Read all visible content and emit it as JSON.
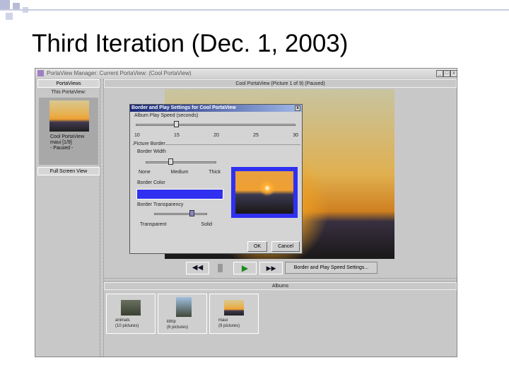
{
  "slide_title": "Third Iteration (Dec. 1, 2003)",
  "window": {
    "title": "PortaView Manager: Current PortaView: (Cool PortaView)",
    "min": "_",
    "max": "□",
    "close": "x"
  },
  "left": {
    "portaviews": "PortaViews",
    "this_portaview": "This PortaView:",
    "name": "Cool PortaView",
    "album": "maui [1/9]",
    "status": "- Paused -",
    "fullscreen": "Full Screen View"
  },
  "main": {
    "header": "Cool PortaView (Picture 1 of 9) (Paused)",
    "settings_button": "Border and Play Speed Settings...",
    "albums_header": "Albums"
  },
  "dialog": {
    "title": "Border and Play Settings for Cool PortaView",
    "close": "x",
    "speed_label": "Album Play Speed (seconds)",
    "speed_value": 15,
    "speed_ticks": [
      "10",
      "15",
      "20",
      "25",
      "30"
    ],
    "picture_border": "Picture Border",
    "border_width": "Border Width",
    "width_labels": [
      "None",
      "Medium",
      "Thick"
    ],
    "width_value": 0.35,
    "border_color": "Border Color",
    "border_color_value": "#3030f0",
    "transparency": "Border Transparency",
    "trans_labels": [
      "Transparent",
      "Solid"
    ],
    "trans_value": 0.7,
    "ok": "OK",
    "cancel": "Cancel"
  },
  "albums": [
    {
      "name": "animals",
      "count": "(10 pictures)"
    },
    {
      "name": "kltrip",
      "count": "(6 pictures)"
    },
    {
      "name": "maui",
      "count": "(9 pictures)"
    }
  ]
}
